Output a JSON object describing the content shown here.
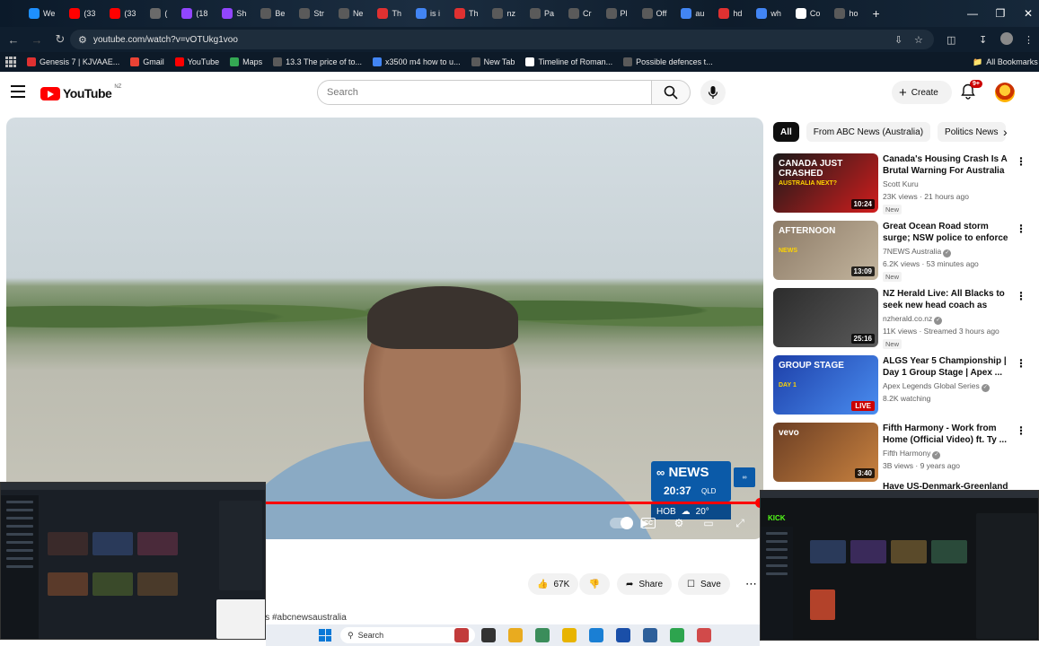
{
  "browser": {
    "tabs": [
      {
        "label": "We",
        "color": "#1e90ff"
      },
      {
        "label": "(33",
        "color": "#ff0000"
      },
      {
        "label": "(33",
        "color": "#ff0000"
      },
      {
        "label": "(",
        "color": "#6a6a6a"
      },
      {
        "label": "(18",
        "color": "#9146ff"
      },
      {
        "label": "Sh",
        "color": "#9146ff"
      },
      {
        "label": "Be",
        "color": "#5a5a5a"
      },
      {
        "label": "Str",
        "color": "#5a5a5a"
      },
      {
        "label": "Ne",
        "color": "#5a5a5a"
      },
      {
        "label": "Th",
        "color": "#e03131"
      },
      {
        "label": "is i",
        "color": "#4285f4"
      },
      {
        "label": "Th",
        "color": "#e03131"
      },
      {
        "label": "nz",
        "color": "#5a5a5a"
      },
      {
        "label": "Pa",
        "color": "#5a5a5a"
      },
      {
        "label": "Cr",
        "color": "#5a5a5a"
      },
      {
        "label": "Pl",
        "color": "#5a5a5a"
      },
      {
        "label": "Off",
        "color": "#5a5a5a"
      },
      {
        "label": "au",
        "color": "#4285f4"
      },
      {
        "label": "hd",
        "color": "#e03131"
      },
      {
        "label": "wh",
        "color": "#4285f4"
      },
      {
        "label": "Co",
        "color": "#ffffff"
      },
      {
        "label": "ho",
        "color": "#5a5a5a"
      }
    ],
    "new_tab_label": "+",
    "url": "youtube.com/watch?v=vOTUkg1voo",
    "bookmarks": [
      {
        "label": "Genesis 7 | KJVAAE...",
        "color": "#e03131"
      },
      {
        "label": "Gmail",
        "color": "#ea4335"
      },
      {
        "label": "YouTube",
        "color": "#ff0000"
      },
      {
        "label": "Maps",
        "color": "#34a853"
      },
      {
        "label": "13.3 The price of to...",
        "color": "#5a5a5a"
      },
      {
        "label": "x3500 m4 how to u...",
        "color": "#4285f4"
      },
      {
        "label": "New Tab",
        "color": "#5a5a5a"
      },
      {
        "label": "Timeline of Roman...",
        "color": "#ffffff"
      },
      {
        "label": "Possible defences t...",
        "color": "#5a5a5a"
      }
    ],
    "all_bookmarks_label": "All Bookmarks"
  },
  "youtube": {
    "logo_text": "YouTube",
    "country_code": "NZ",
    "search_placeholder": "Search",
    "create_label": "Create",
    "notification_count": "9+",
    "player": {
      "news_brand": "NEWS",
      "news_time": "20:37",
      "news_zone": "QLD",
      "weather_city": "HOB",
      "weather_temp": "20°",
      "progress_fraction": 0.995
    },
    "actions": {
      "likes": "67K",
      "share_label": "Share",
      "save_label": "Save"
    },
    "description_hashtag": "ws #abcnewsaustralia",
    "chips": [
      "All",
      "From ABC News (Australia)",
      "Politics News"
    ],
    "recommendations": [
      {
        "title": "Canada's Housing Crash Is A Brutal Warning For Australia ...",
        "channel": "Scott Kuru",
        "meta": "23K views · 21 hours ago",
        "badge": "New",
        "duration": "10:24",
        "thumb_text": "CANADA JUST CRASHED",
        "thumb_sub": "AUSTRALIA NEXT?",
        "colors": [
          "#1a1a1a",
          "#d11d1d"
        ]
      },
      {
        "title": "Great Ocean Road storm surge; NSW police to enforce protest ...",
        "channel": "7NEWS Australia",
        "meta": "6.2K views · 53 minutes ago",
        "badge": "New",
        "duration": "13:09",
        "thumb_text": "AFTERNOON",
        "thumb_sub": "NEWS",
        "colors": [
          "#8c7a66",
          "#c3b59e"
        ]
      },
      {
        "title": "NZ Herald Live: All Blacks to seek new head coach as Scott...",
        "channel": "nzherald.co.nz",
        "meta": "11K views · Streamed 3 hours ago",
        "badge": "New",
        "duration": "25:16",
        "thumb_text": "",
        "thumb_sub": "",
        "colors": [
          "#2c2c2c",
          "#5a5a5a"
        ]
      },
      {
        "title": "ALGS Year 5 Championship | Day 1 Group Stage | Apex ...",
        "channel": "Apex Legends Global Series",
        "meta": "8.2K watching",
        "badge": "",
        "duration": "LIVE",
        "thumb_text": "GROUP STAGE",
        "thumb_sub": "DAY 1",
        "colors": [
          "#1d3fa8",
          "#4a8df0"
        ]
      },
      {
        "title": "Fifth Harmony - Work from Home (Official Video) ft. Ty ...",
        "channel": "Fifth Harmony",
        "meta": "3B views · 9 years ago",
        "badge": "",
        "duration": "3:40",
        "thumb_text": "vevo",
        "thumb_sub": "",
        "colors": [
          "#6b3e24",
          "#c9823f"
        ]
      }
    ],
    "partial_title": "Have US-Denmark-Greenland"
  },
  "overlays": {
    "right_logo": "KICK"
  },
  "taskbar": {
    "search_label": "Search",
    "apps": [
      "#c23b3b",
      "#333333",
      "#e9ab1f",
      "#3b8d5b",
      "#e8b400",
      "#1a7fd4",
      "#1a4fa8",
      "#2d5f9a",
      "#2da44e",
      "#d14a4a"
    ]
  }
}
